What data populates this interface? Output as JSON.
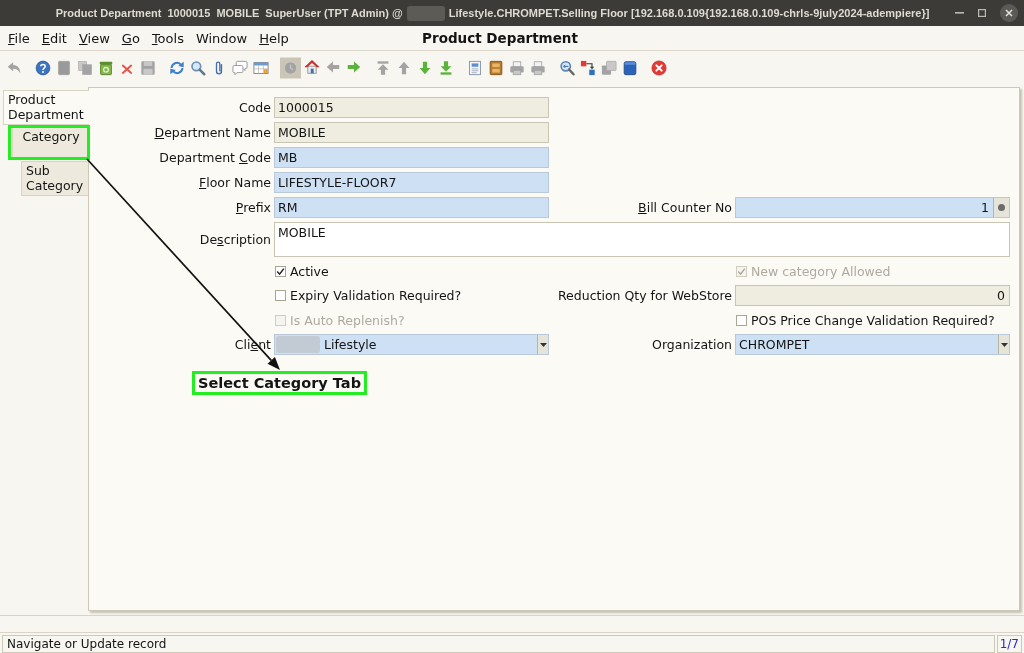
{
  "window": {
    "title_start": "Product Department  1000015  MOBILE  SuperUser (TPT Admin) @",
    "title_redacted": true,
    "title_end": "Lifestyle.CHROMPET.Selling Floor [192.168.0.109{192.168.0.109-chrls-9july2024-adempiere}]"
  },
  "menu": [
    {
      "label": [
        {
          "text": "F",
          "underlined": true
        },
        {
          "text": "ile",
          "underlined": false
        }
      ]
    },
    {
      "label": [
        {
          "text": "E",
          "underlined": true
        },
        {
          "text": "dit",
          "underlined": false
        }
      ]
    },
    {
      "label": [
        {
          "text": "V",
          "underlined": true
        },
        {
          "text": "iew",
          "underlined": false
        }
      ]
    },
    {
      "label": [
        {
          "text": "G",
          "underlined": true
        },
        {
          "text": "o",
          "underlined": false
        }
      ]
    },
    {
      "label": [
        {
          "text": "T",
          "underlined": true
        },
        {
          "text": "ools",
          "underlined": false
        }
      ]
    },
    {
      "label": [
        {
          "text": "Window",
          "underlined": false
        }
      ]
    },
    {
      "label": [
        {
          "text": "H",
          "underlined": true
        },
        {
          "text": "elp",
          "underlined": false
        }
      ]
    }
  ],
  "window_heading": "Product Department",
  "toolbar": {
    "groups": [
      {
        "buttons": [
          {
            "kind": "undo",
            "disabled": true,
            "pressed": false
          }
        ]
      },
      {
        "buttons": [
          {
            "kind": "help",
            "disabled": false,
            "pressed": false
          },
          {
            "kind": "new",
            "disabled": true,
            "pressed": false
          },
          {
            "kind": "copy",
            "disabled": true,
            "pressed": false
          },
          {
            "kind": "delete",
            "disabled": false,
            "pressed": false
          },
          {
            "kind": "deleteall",
            "disabled": false,
            "pressed": false
          },
          {
            "kind": "save",
            "disabled": true,
            "pressed": false
          }
        ]
      },
      {
        "buttons": [
          {
            "kind": "refresh",
            "disabled": false,
            "pressed": false
          },
          {
            "kind": "find",
            "disabled": false,
            "pressed": false
          },
          {
            "kind": "attach",
            "disabled": false,
            "pressed": false
          },
          {
            "kind": "chat",
            "disabled": false,
            "pressed": false
          },
          {
            "kind": "grid",
            "disabled": false,
            "pressed": false
          }
        ]
      },
      {
        "buttons": [
          {
            "kind": "history",
            "disabled": true,
            "pressed": true
          },
          {
            "kind": "home",
            "disabled": false,
            "pressed": false
          },
          {
            "kind": "parent",
            "disabled": true,
            "pressed": false
          },
          {
            "kind": "detail",
            "disabled": false,
            "pressed": false
          }
        ]
      },
      {
        "buttons": [
          {
            "kind": "first",
            "disabled": true,
            "pressed": false
          },
          {
            "kind": "previous",
            "disabled": true,
            "pressed": false
          },
          {
            "kind": "next",
            "disabled": false,
            "pressed": false
          },
          {
            "kind": "last",
            "disabled": false,
            "pressed": false
          }
        ]
      },
      {
        "buttons": [
          {
            "kind": "report",
            "disabled": false,
            "pressed": false
          },
          {
            "kind": "archive",
            "disabled": false,
            "pressed": false
          },
          {
            "kind": "preview",
            "disabled": true,
            "pressed": false
          },
          {
            "kind": "print",
            "disabled": true,
            "pressed": false
          }
        ]
      },
      {
        "buttons": [
          {
            "kind": "zoom",
            "disabled": false,
            "pressed": false
          },
          {
            "kind": "workflow",
            "disabled": false,
            "pressed": false
          },
          {
            "kind": "request",
            "disabled": true,
            "pressed": false
          },
          {
            "kind": "product",
            "disabled": false,
            "pressed": false
          }
        ]
      },
      {
        "buttons": [
          {
            "kind": "exit",
            "disabled": false,
            "pressed": false
          }
        ]
      }
    ]
  },
  "tabs": [
    {
      "label": "Product Department",
      "selected": true,
      "highlighted": false,
      "children": [
        {
          "label": "Category",
          "selected": false,
          "highlighted": true,
          "children": [
            {
              "label": "Sub Category",
              "selected": false,
              "highlighted": false
            }
          ]
        }
      ]
    }
  ],
  "form": {
    "rows": [
      {
        "cells": [
          {
            "kind": "text",
            "label": [
              {
                "text": "Code",
                "underlined": false
              }
            ],
            "value": "1000015",
            "readonly": true
          }
        ]
      },
      {
        "cells": [
          {
            "kind": "text",
            "label": [
              {
                "text": "D",
                "underlined": true
              },
              {
                "text": "epartment Name",
                "underlined": false
              }
            ],
            "value": "MOBILE",
            "readonly": true
          }
        ]
      },
      {
        "cells": [
          {
            "kind": "text",
            "label": [
              {
                "text": "Department ",
                "underlined": false
              },
              {
                "text": "C",
                "underlined": true
              },
              {
                "text": "ode",
                "underlined": false
              }
            ],
            "value": "MB",
            "readonly": false,
            "mandatory": true
          }
        ]
      },
      {
        "cells": [
          {
            "kind": "text",
            "label": [
              {
                "text": "F",
                "underlined": true
              },
              {
                "text": "loor Name",
                "underlined": false
              }
            ],
            "value": "LIFESTYLE-FLOOR7",
            "readonly": false,
            "mandatory": true
          }
        ]
      },
      {
        "cells": [
          {
            "kind": "text",
            "label": [
              {
                "text": "P",
                "underlined": true
              },
              {
                "text": "refix",
                "underlined": false
              }
            ],
            "value": "RM",
            "readonly": false,
            "mandatory": true
          },
          {
            "kind": "number",
            "label": [
              {
                "text": "B",
                "underlined": true
              },
              {
                "text": "ill Counter No",
                "underlined": false
              }
            ],
            "value": "1",
            "readonly": false,
            "mandatory": true,
            "button": true
          }
        ]
      },
      {
        "cells": [
          {
            "kind": "textarea",
            "label": [
              {
                "text": "De",
                "underlined": false
              },
              {
                "text": "s",
                "underlined": true
              },
              {
                "text": "cription",
                "underlined": false
              }
            ],
            "value": "MOBILE",
            "readonly": false,
            "mandatory": false
          }
        ]
      },
      {
        "cells": [
          {
            "kind": "checkbox",
            "label": [
              {
                "text": "Active",
                "underlined": false
              }
            ],
            "checked": true,
            "disabled": false
          },
          {
            "kind": "checkbox",
            "label": [
              {
                "text": "New category Allowed",
                "underlined": false
              }
            ],
            "checked": true,
            "disabled": true
          }
        ]
      },
      {
        "cells": [
          {
            "kind": "checkbox",
            "label": [
              {
                "text": "Expiry Validation Required?",
                "underlined": false
              }
            ],
            "checked": false,
            "disabled": false
          },
          {
            "kind": "number",
            "label": [
              {
                "text": "Reduction Qty for WebStore",
                "underlined": false
              }
            ],
            "value": "0",
            "readonly": true,
            "button": false
          }
        ]
      },
      {
        "cells": [
          {
            "kind": "checkbox",
            "label": [
              {
                "text": "Is Auto Replenish?",
                "underlined": false
              }
            ],
            "checked": false,
            "disabled": true
          },
          {
            "kind": "checkbox",
            "label": [
              {
                "text": "POS Price Change Validation Required?",
                "underlined": false
              }
            ],
            "checked": false,
            "disabled": false
          }
        ]
      },
      {
        "cells": [
          {
            "kind": "combo",
            "label": [
              {
                "text": "Cli",
                "underlined": false
              },
              {
                "text": "e",
                "underlined": true
              },
              {
                "text": "nt",
                "underlined": false
              }
            ],
            "value": "Lifestyle",
            "redacted": true,
            "readonly": false,
            "mandatory": true
          },
          {
            "kind": "combo",
            "label": [
              {
                "text": "Organization",
                "underlined": false
              }
            ],
            "value": "CHROMPET",
            "redacted": false,
            "readonly": false,
            "mandatory": true
          }
        ]
      }
    ]
  },
  "annotation": {
    "callout": "Select Category Tab",
    "arrow": true
  },
  "status_bar": {
    "message": "Navigate or Update record",
    "record": "1/7"
  }
}
